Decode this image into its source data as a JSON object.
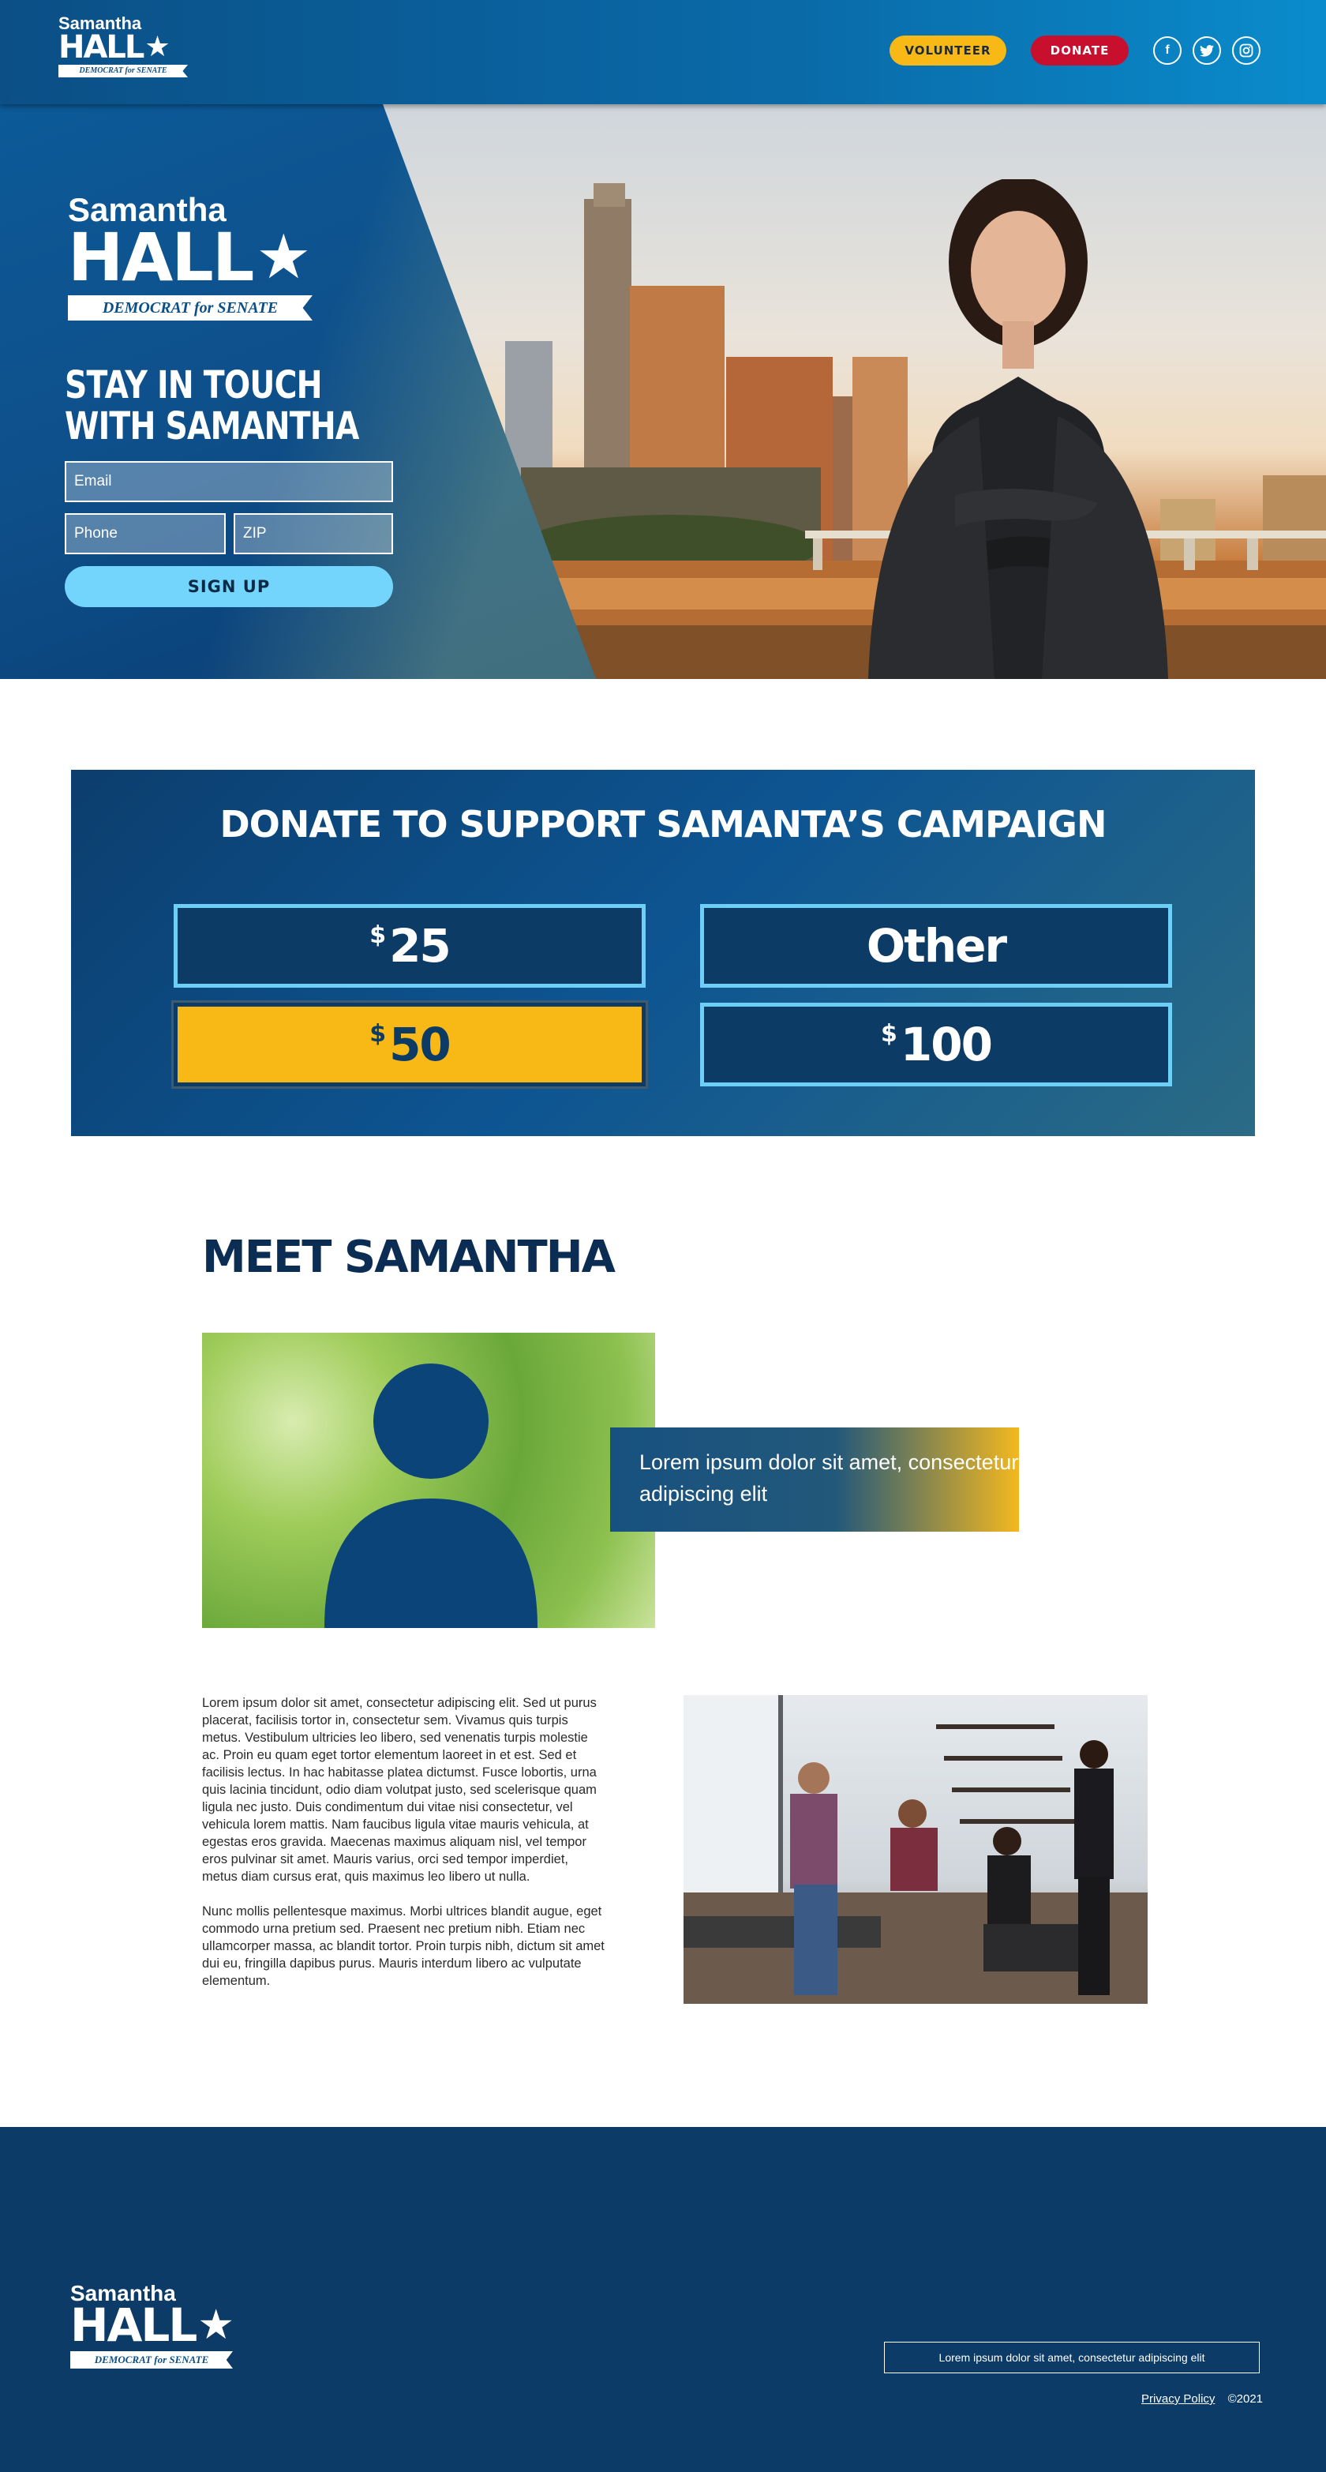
{
  "header": {
    "logo": {
      "first": "Samantha",
      "last": "HALL",
      "tagline": "DEMOCRAT for SENATE"
    },
    "volunteer_label": "VOLUNTEER",
    "donate_label": "DONATE",
    "social": [
      {
        "icon": "facebook-icon",
        "glyph": "f"
      },
      {
        "icon": "twitter-icon",
        "glyph": "🐦"
      },
      {
        "icon": "instagram-icon",
        "glyph": "◎"
      }
    ]
  },
  "hero": {
    "logo": {
      "first": "Samantha",
      "last": "HALL",
      "tagline": "DEMOCRAT for SENATE"
    },
    "title_line1": "STAY IN TOUCH",
    "title_line2": "WITH SAMANTHA",
    "email_placeholder": "Email",
    "phone_placeholder": "Phone",
    "zip_placeholder": "ZIP",
    "signup_label": "SIGN UP"
  },
  "donate": {
    "title": "DONATE TO SUPPORT SAMANTA’S CAMPAIGN",
    "currency": "$",
    "amounts": [
      "25",
      "Other",
      "50",
      "100"
    ],
    "selected": "50"
  },
  "meet": {
    "title": "MEET SAMANTHA",
    "callout": "Lorem ipsum dolor sit amet, consectetur adipiscing elit",
    "paragraph1": "Lorem ipsum dolor sit amet, consectetur adipiscing elit. Sed ut purus placerat, facilisis tortor in, consectetur sem. Vivamus quis turpis metus. Vestibulum ultricies leo libero, sed venenatis turpis molestie ac. Proin eu quam eget tortor elementum laoreet in et est. Sed et facilisis lectus. In hac habitasse platea dictumst. Fusce lobortis, urna quis lacinia tincidunt, odio diam volutpat justo, sed scelerisque quam ligula nec justo. Duis condimentum dui vitae nisi consectetur, vel vehicula lorem mattis. Nam faucibus ligula vitae mauris vehicula, at egestas eros gravida. Maecenas maximus aliquam nisl, vel tempor eros pulvinar sit amet. Mauris varius, orci sed tempor imperdiet, metus diam cursus erat, quis maximus leo libero ut nulla.",
    "paragraph2": "Nunc mollis pellentesque maximus. Morbi ultrices blandit augue, eget commodo urna pretium sed. Praesent nec pretium nibh. Etiam nec ullamcorper massa, ac blandit tortor. Proin turpis nibh, dictum sit amet dui eu, fringilla dapibus purus. Mauris interdum libero ac vulputate elementum."
  },
  "footer": {
    "logo": {
      "first": "Samantha",
      "last": "HALL",
      "tagline": "DEMOCRAT for SENATE"
    },
    "box_text": "Lorem ipsum dolor sit amet, consectetur adipiscing elit",
    "privacy_label": "Privacy Policy",
    "copyright": "©2021"
  },
  "colors": {
    "navy": "#0b3b66",
    "blue": "#0d5592",
    "light_blue": "#73d5fb",
    "gold": "#f8b816",
    "red": "#c8102e"
  }
}
